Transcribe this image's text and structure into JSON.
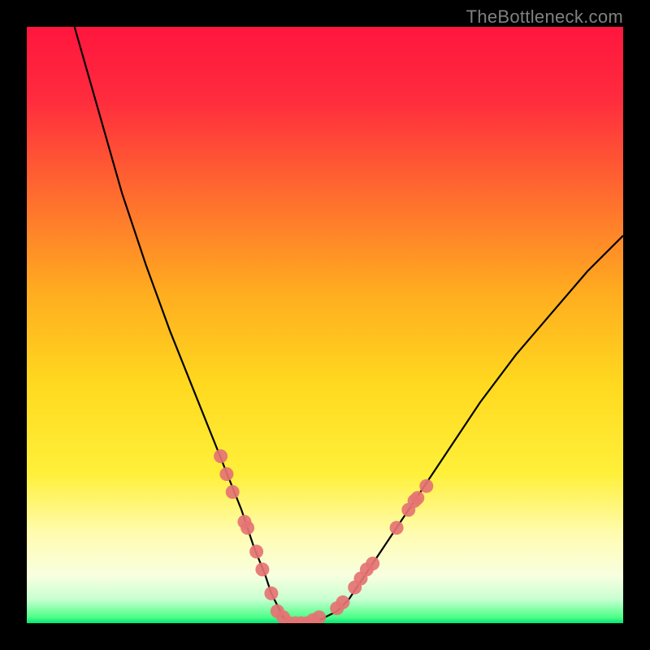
{
  "watermark": "TheBottleneck.com",
  "gradient_colors": {
    "top": "#ff1744",
    "upper_mid": "#ff5722",
    "mid": "#ffc107",
    "lower_mid": "#ffeb3b",
    "near_bottom": "#f0f4c3",
    "bottom": "#00e676"
  },
  "chart_data": {
    "type": "line",
    "title": "",
    "xlabel": "",
    "ylabel": "",
    "xlim": [
      0,
      100
    ],
    "ylim": [
      0,
      100
    ],
    "series": [
      {
        "name": "curve",
        "x": [
          8,
          12,
          16,
          20,
          24,
          28,
          32,
          36,
          38,
          40,
          41,
          42,
          43,
          44,
          45,
          46,
          48,
          50,
          52,
          54,
          56,
          60,
          64,
          70,
          76,
          82,
          88,
          94,
          100
        ],
        "y": [
          100,
          86,
          72,
          60,
          49,
          39,
          29,
          19,
          13,
          8,
          5,
          3,
          1,
          0,
          0,
          0,
          0,
          1,
          2,
          4,
          7,
          13,
          19,
          28,
          37,
          45,
          52,
          59,
          65
        ]
      }
    ],
    "markers": [
      {
        "x": 32.5,
        "y": 28
      },
      {
        "x": 33.5,
        "y": 25
      },
      {
        "x": 34.5,
        "y": 22
      },
      {
        "x": 36.5,
        "y": 17
      },
      {
        "x": 37,
        "y": 16
      },
      {
        "x": 38.5,
        "y": 12
      },
      {
        "x": 39.5,
        "y": 9
      },
      {
        "x": 41,
        "y": 5
      },
      {
        "x": 42,
        "y": 2
      },
      {
        "x": 43,
        "y": 1
      },
      {
        "x": 44,
        "y": 0
      },
      {
        "x": 45,
        "y": 0
      },
      {
        "x": 46,
        "y": 0
      },
      {
        "x": 47,
        "y": 0
      },
      {
        "x": 48,
        "y": 0.5
      },
      {
        "x": 49,
        "y": 1
      },
      {
        "x": 52,
        "y": 2.5
      },
      {
        "x": 53,
        "y": 3.5
      },
      {
        "x": 55,
        "y": 6
      },
      {
        "x": 56,
        "y": 7.5
      },
      {
        "x": 57,
        "y": 9
      },
      {
        "x": 58,
        "y": 10
      },
      {
        "x": 62,
        "y": 16
      },
      {
        "x": 64,
        "y": 19
      },
      {
        "x": 65,
        "y": 20.5
      },
      {
        "x": 65.5,
        "y": 21
      },
      {
        "x": 67,
        "y": 23
      }
    ],
    "marker_color": "#e57373",
    "curve_color": "#000000"
  }
}
